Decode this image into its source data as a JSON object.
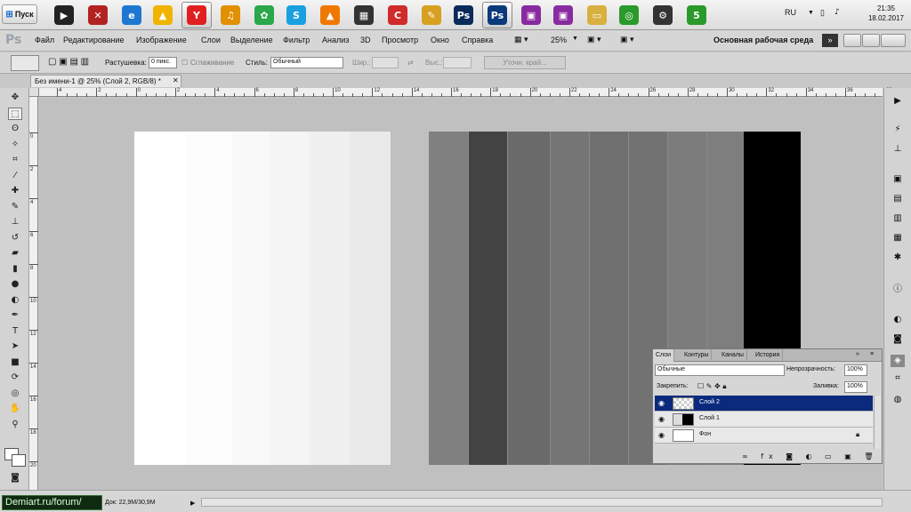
{
  "taskbar": {
    "start_label": "Пуск",
    "apps": [
      {
        "name": "winamp-icon",
        "glyph": "▶",
        "color": "#222222"
      },
      {
        "name": "crossout-icon",
        "glyph": "✕",
        "color": "#b22222"
      },
      {
        "name": "ie-icon",
        "glyph": "e",
        "color": "#1e78d2"
      },
      {
        "name": "aimp-icon",
        "glyph": "▲",
        "color": "#f0b400"
      },
      {
        "name": "yandex-icon",
        "glyph": "Y",
        "color": "#e02020"
      },
      {
        "name": "headphones-icon",
        "glyph": "♫",
        "color": "#e09000"
      },
      {
        "name": "icq-icon",
        "glyph": "✿",
        "color": "#2aa84a"
      },
      {
        "name": "skype-icon",
        "glyph": "S",
        "color": "#1aa0e0"
      },
      {
        "name": "vlc-icon",
        "glyph": "▲",
        "color": "#f07800"
      },
      {
        "name": "qr-icon",
        "glyph": "▦",
        "color": "#333333"
      },
      {
        "name": "ccleaner-icon",
        "glyph": "C",
        "color": "#d02a2a"
      },
      {
        "name": "paint-icon",
        "glyph": "✎",
        "color": "#d8a020"
      },
      {
        "name": "photoshop-icon",
        "glyph": "Ps",
        "color": "#0a2a5a"
      },
      {
        "name": "photoshop-active-icon",
        "glyph": "Ps",
        "color": "#0a3a7a"
      },
      {
        "name": "video-icon",
        "glyph": "▣",
        "color": "#8a2aa0"
      },
      {
        "name": "video2-icon",
        "glyph": "▣",
        "color": "#8a2aa0"
      },
      {
        "name": "folder-icon",
        "glyph": "▭",
        "color": "#d8b040"
      },
      {
        "name": "globe-icon",
        "glyph": "◎",
        "color": "#2a9a2a"
      },
      {
        "name": "settings-icon",
        "glyph": "⚙",
        "color": "#333333"
      },
      {
        "name": "five-icon",
        "glyph": "5",
        "color": "#2a9a2a"
      }
    ],
    "tray": {
      "lang": "RU",
      "time": "21:35",
      "date": "18.02.2017"
    }
  },
  "menubar": {
    "items": [
      "Файл",
      "Редактирование",
      "Изображение",
      "Слои",
      "Выделение",
      "Фильтр",
      "Анализ",
      "3D",
      "Просмотр",
      "Окно",
      "Справка"
    ],
    "zoom": "25%",
    "workspace": "Основная рабочая среда"
  },
  "options": {
    "feather_label": "Растушевка:",
    "feather_value": "0 пикс.",
    "antialias_label": "Сглаживание",
    "style_label": "Стиль:",
    "style_value": "Обычный",
    "width_label": "Шир.:",
    "height_label": "Выс.:",
    "refine_label": "Уточн. край..."
  },
  "document": {
    "tab_title": "Без имени-1 @ 25% (Слой 2, RGB/8) *"
  },
  "ruler": {
    "h": [
      "4",
      "2",
      "0",
      "2",
      "4",
      "6",
      "8",
      "10",
      "12",
      "14",
      "16",
      "18",
      "20",
      "22",
      "24",
      "26",
      "28",
      "30",
      "32",
      "34",
      "36",
      "38"
    ],
    "v": [
      "0",
      "2",
      "4",
      "6",
      "8",
      "10",
      "12",
      "14",
      "16",
      "18",
      "20",
      "22",
      "24"
    ]
  },
  "canvas": {
    "white_stripes": [
      "#ffffff",
      "#fdfdfd",
      "#f9f9f9",
      "#f5f5f5",
      "#f0f0f0",
      "#eaeaea"
    ],
    "gray_stripes": [
      "#808080",
      "#434343",
      "#6a6a6a",
      "#757575",
      "#6f6f6f",
      "#727272",
      "#7c7c7c",
      "#7e7e7e",
      "#000000"
    ]
  },
  "layers": {
    "tabs": [
      "Слои",
      "Контуры",
      "Каналы",
      "История"
    ],
    "blend_mode": "Обычные",
    "opacity_label": "Непрозрачность:",
    "opacity_value": "100%",
    "lock_label": "Закрепить:",
    "fill_label": "Заливка:",
    "fill_value": "100%",
    "rows": [
      {
        "name": "Слой 2",
        "selected": true
      },
      {
        "name": "Слой 1",
        "selected": false
      },
      {
        "name": "Фон",
        "selected": false
      }
    ]
  },
  "status": {
    "doc_info": "Док: 22,9M/30,9M",
    "watermark": "Demiart.ru/forum/"
  }
}
